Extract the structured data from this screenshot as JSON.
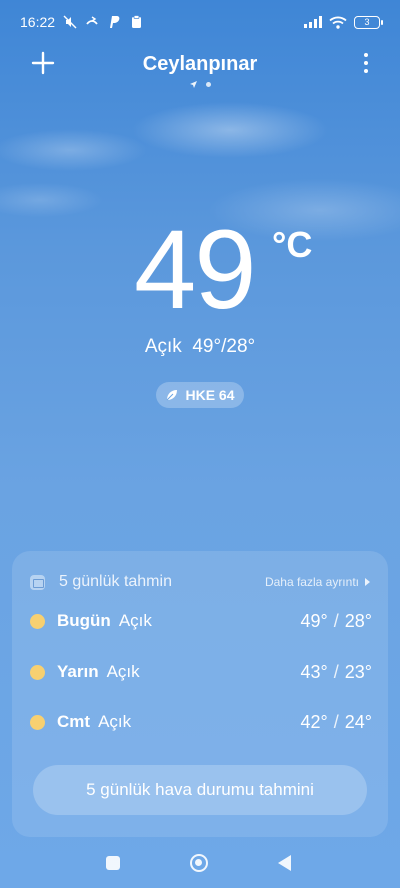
{
  "status_bar": {
    "time": "16:22",
    "battery_level": "3",
    "icons": [
      "mute-icon",
      "call-forward-icon",
      "paypal-icon",
      "clipboard-icon",
      "signal-icon",
      "wifi-icon",
      "battery-icon"
    ]
  },
  "header": {
    "city": "Ceylanpınar",
    "location_pages": [
      "location-arrow",
      "dot"
    ]
  },
  "current": {
    "temperature": "49",
    "unit": "°C",
    "condition_line": "Açık  49°/28°",
    "aqi_label": "HKE 64"
  },
  "forecast_card": {
    "title": "5 günlük tahmin",
    "more_label": "Daha fazla ayrıntı",
    "days": [
      {
        "day": "Bugün",
        "condition": "Açık",
        "high": "49°",
        "low": "28°"
      },
      {
        "day": "Yarın",
        "condition": "Açık",
        "high": "43°",
        "low": "23°"
      },
      {
        "day": "Cmt",
        "condition": "Açık",
        "high": "42°",
        "low": "24°"
      }
    ],
    "button_label": "5 günlük hava durumu tahmini"
  },
  "colors": {
    "sky_top": "#3f86d6",
    "sky_bottom": "#6ea8e8",
    "sun_icon": "#f7d071"
  }
}
